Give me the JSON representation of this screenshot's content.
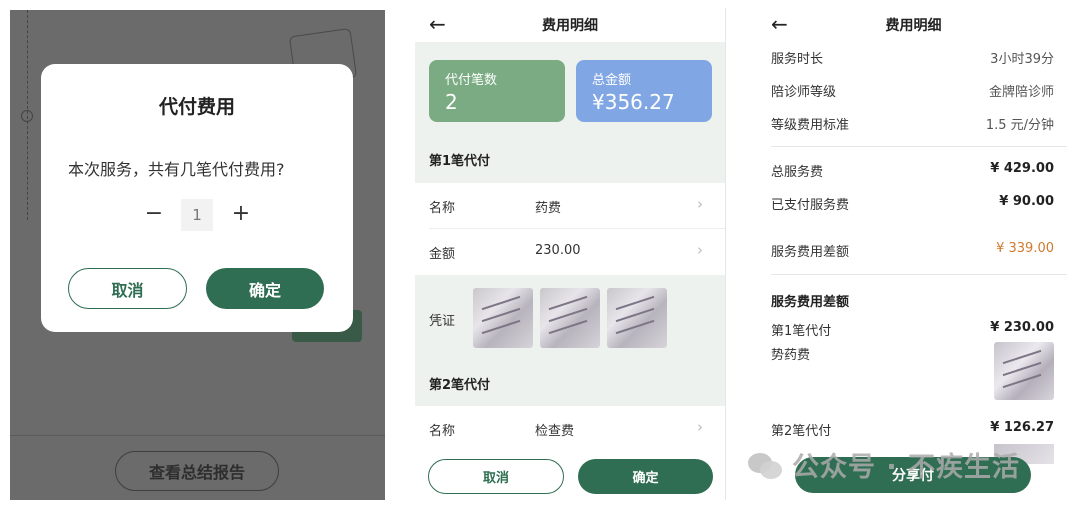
{
  "panel1": {
    "dialog": {
      "title": "代付费用",
      "question": "本次服务，共有几笔代付费用?",
      "minus": "−",
      "quantity": "1",
      "plus": "+",
      "cancel": "取消",
      "confirm": "确定"
    },
    "report_button": "查看总结报告"
  },
  "panel2": {
    "nav": {
      "back": "←",
      "title": "费用明细"
    },
    "summary": {
      "count_label": "代付笔数",
      "count_value": "2",
      "total_label": "总金额",
      "total_value": "¥356.27",
      "count_color": "#7aab83",
      "total_color": "#80a7e4"
    },
    "payments": [
      {
        "heading": "第1笔代付",
        "name_label": "名称",
        "name_value": "药费",
        "amount_label": "金额",
        "amount_value": "230.00",
        "voucher_label": "凭证",
        "voucher_count": 3
      },
      {
        "heading": "第2笔代付",
        "name_label": "名称",
        "name_value": "检查费"
      }
    ],
    "footer": {
      "cancel": "取消",
      "confirm": "确定"
    }
  },
  "panel3": {
    "nav": {
      "back": "←",
      "title": "费用明细"
    },
    "info_rows": [
      {
        "label": "服务时长",
        "value": "3小时39分"
      },
      {
        "label": "陪诊师等级",
        "value": "金牌陪诊师"
      },
      {
        "label": "等级费用标准",
        "value": "1.5 元/分钟"
      }
    ],
    "fee_rows": [
      {
        "label": "总服务费",
        "value": "¥ 429.00"
      },
      {
        "label": "已支付服务费",
        "value": "¥ 90.00"
      },
      {
        "label": "服务费用差额",
        "value": "¥ 339.00",
        "color": "#d07a2e"
      }
    ],
    "section_title": "服务费用差额",
    "payment1": {
      "label": "第1笔代付",
      "value": "¥ 230.00",
      "name": "势药费"
    },
    "payment2": {
      "label": "第2笔代付",
      "value": "¥ 126.27"
    },
    "share_button": "分享付"
  },
  "watermark": {
    "text": "公众号 · 不疾生活",
    "icon": "wechat-icon"
  },
  "colors": {
    "primary": "#2f6e52",
    "accent_orange": "#d07a2e"
  }
}
